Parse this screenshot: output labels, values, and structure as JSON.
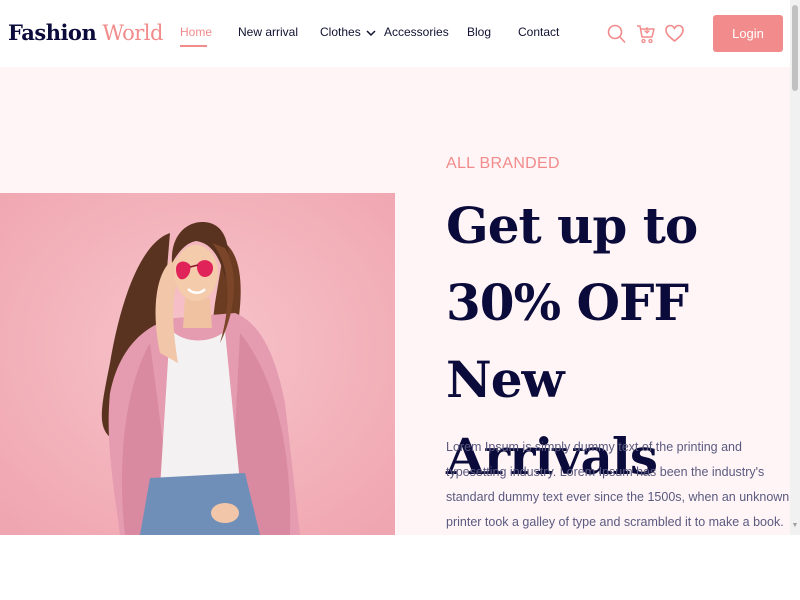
{
  "brand": {
    "first": "Fashion",
    "second": "World"
  },
  "nav": {
    "items": [
      {
        "label": "Home",
        "active": true
      },
      {
        "label": "New arrival",
        "active": false
      },
      {
        "label": "Clothes",
        "active": false,
        "has_dropdown": true
      },
      {
        "label": "Accessories",
        "active": false
      },
      {
        "label": "Blog",
        "active": false
      },
      {
        "label": "Contact",
        "active": false
      }
    ]
  },
  "header_icons": [
    "search-icon",
    "cart-icon",
    "heart-icon"
  ],
  "login": {
    "label": "Login"
  },
  "hero": {
    "eyebrow": "ALL BRANDED",
    "headline": "Get up to 30% OFF New Arrivals",
    "description": "Lorem Ipsum is simply dummy text of the printing and typesetting industry. Lorem Ipsum has been the industry's standard dummy text ever since the 1500s, when an unknown printer took a galley of type and scrambled it to make a book."
  },
  "colors": {
    "accent": "#f28b8b",
    "navy": "#0b0b3b",
    "hero_bg": "#fff5f6",
    "image_bg": "#f4b8c0"
  }
}
